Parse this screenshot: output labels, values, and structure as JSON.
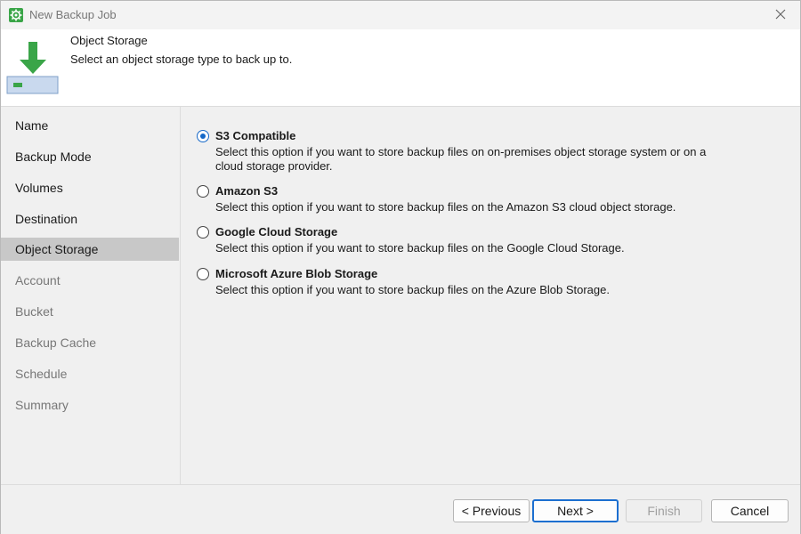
{
  "window": {
    "title": "New Backup Job",
    "app_icon": "gear-icon",
    "close_icon": "close-icon"
  },
  "header": {
    "title": "Object Storage",
    "subtitle": "Select an object storage type to back up to.",
    "icon": "download-arrow-storage-icon"
  },
  "sidebar": {
    "items": [
      {
        "label": "Name",
        "state": "done"
      },
      {
        "label": "Backup Mode",
        "state": "done"
      },
      {
        "label": "Volumes",
        "state": "done"
      },
      {
        "label": "Destination",
        "state": "done"
      },
      {
        "label": "Object Storage",
        "state": "active"
      },
      {
        "label": "Account",
        "state": "pending"
      },
      {
        "label": "Bucket",
        "state": "pending"
      },
      {
        "label": "Backup Cache",
        "state": "pending"
      },
      {
        "label": "Schedule",
        "state": "pending"
      },
      {
        "label": "Summary",
        "state": "pending"
      }
    ]
  },
  "options": [
    {
      "label": "S3 Compatible",
      "checked": true,
      "description": "Select this option if you want to store backup files on on-premises object storage system or on a cloud storage provider."
    },
    {
      "label": "Amazon S3",
      "checked": false,
      "description": "Select this option if you want to store backup files on the Amazon S3 cloud object storage."
    },
    {
      "label": "Google Cloud Storage",
      "checked": false,
      "description": "Select this option if you want to store backup files on the Google Cloud Storage."
    },
    {
      "label": "Microsoft Azure Blob Storage",
      "checked": false,
      "description": "Select this option if you want to store backup files on the Azure Blob Storage."
    }
  ],
  "footer": {
    "previous_label": "< Previous",
    "next_label": "Next >",
    "finish_label": "Finish",
    "cancel_label": "Cancel"
  },
  "colors": {
    "accent": "#1c6fd0",
    "radio_checked": "#1668c8",
    "brand_green": "#3aa548",
    "active_nav": "#c8c8c8",
    "pending_nav_text": "#777777"
  }
}
